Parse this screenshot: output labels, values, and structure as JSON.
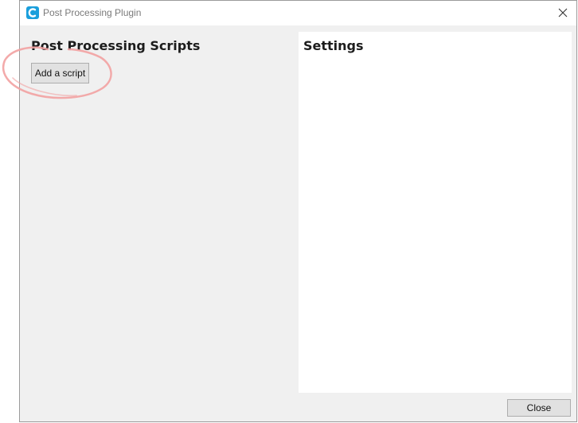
{
  "window": {
    "title": "Post Processing Plugin",
    "icon": "cura-app-icon",
    "close_icon": "close-icon"
  },
  "left_panel": {
    "heading": "Post Processing Scripts",
    "add_button_label": "Add a script"
  },
  "right_panel": {
    "heading": "Settings"
  },
  "footer": {
    "close_label": "Close"
  },
  "colors": {
    "app_icon": "#1a9fdc",
    "annotation": "#f2a1a1",
    "window_bg": "#f0f0f0",
    "panel_bg": "#ffffff"
  }
}
